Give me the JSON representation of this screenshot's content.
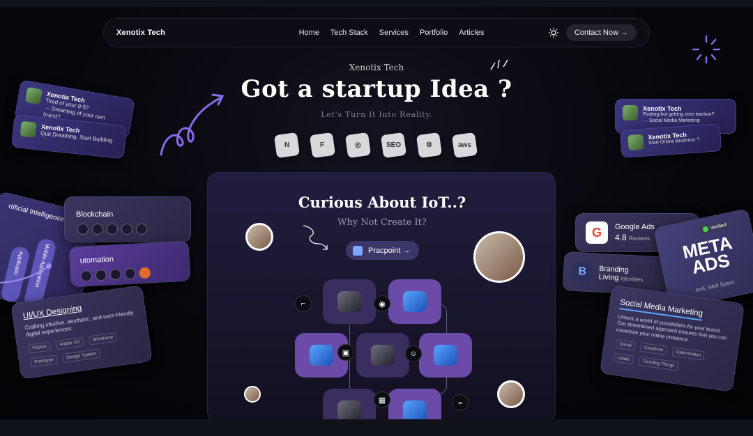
{
  "nav": {
    "brand": "Xenotix Tech",
    "links": [
      "Home",
      "Tech Stack",
      "Services",
      "Portfolio",
      "Articles"
    ],
    "contact": "Contact Now →"
  },
  "hero": {
    "eyebrow": "Xenotix Tech",
    "title": "Got a startup Idea ?",
    "subtitle": "Let's Turn It Into Reality."
  },
  "tech_tiles": [
    "N",
    "F",
    "◎",
    "SEO",
    "⚙",
    "aws"
  ],
  "iot": {
    "title": "Curious About IoT..?",
    "subtitle": "Why Not Create It?",
    "button": "Pracpoint →"
  },
  "left_cards": {
    "card1": {
      "name": "Xenotix Tech",
      "text": "Tired of your 9-5?\n→ Dreaming of your own brand?"
    },
    "card2": {
      "name": "Xenotix Tech",
      "text": "Quit Dreaming. Start Building"
    },
    "blockchain": "Blockchain",
    "ai": "rtificial Intelligence",
    "automation": "utomation",
    "mobile": "Mobile Application",
    "app": "Applicatio",
    "uiux": {
      "title": "UI/UX Designing",
      "text": "Crafting intuitive, aesthetic, and user-friendly digital experiences",
      "chips": [
        "FIGMA",
        "Adobe XD",
        "Wireframe",
        "Prototype",
        "Design System"
      ]
    }
  },
  "right_cards": {
    "card1": {
      "name": "Xenotix Tech",
      "text": "Posting but getting zero traction?\n→ Social Media Marketing"
    },
    "card2": {
      "name": "Xenotix Tech",
      "text": "Start Online Business ?"
    },
    "google": {
      "title": "Google Ads",
      "rating": "4.8",
      "rating_label": "Reviews"
    },
    "branding": {
      "title": "Branding",
      "sub": "Living",
      "sub2": "Identities"
    },
    "meta": {
      "title": "META ADS",
      "verified": "Verified",
      "tagline": "end. Well Spent."
    },
    "smm": {
      "title": "Social Media Marketing",
      "text": "Unlock a world of possibilities for your brand. Our streamlined approach ensures that you can maximize your online presence.",
      "chips": [
        "Social",
        "Creatives",
        "Optimization",
        "Leads",
        "Trending Things"
      ]
    }
  },
  "colors": {
    "accent": "#6b4aa8",
    "card": "#211d3e",
    "bg": "#07070c"
  }
}
